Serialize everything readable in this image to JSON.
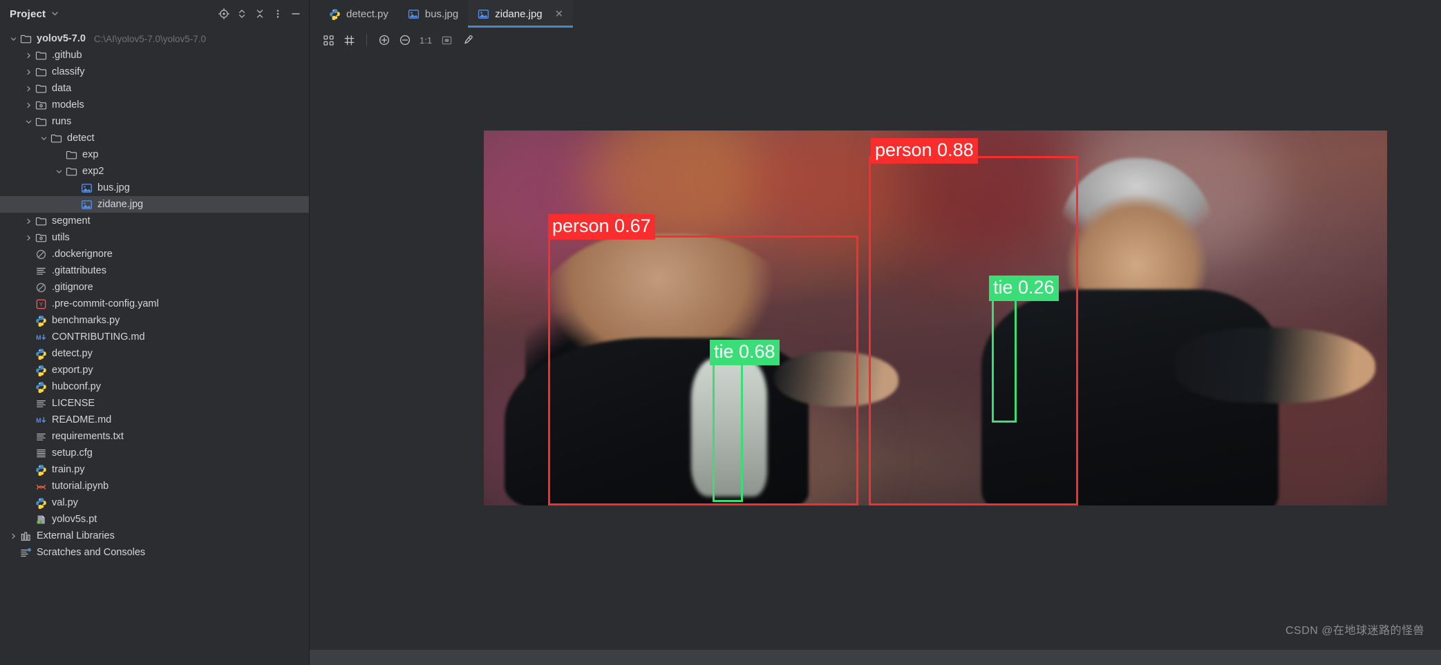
{
  "window": {
    "background_color": "#2b2d30",
    "accent_color": "#4a88c7"
  },
  "project_panel": {
    "title": "Project",
    "title_chevron": "chevron-down-icon",
    "toolbar_icons": [
      {
        "name": "locate-icon",
        "label": "Select Opened File"
      },
      {
        "name": "expand-collapse-icon",
        "label": "Expand All"
      },
      {
        "name": "collapse-all-icon",
        "label": "Collapse All"
      },
      {
        "name": "more-options-icon",
        "label": "Options"
      },
      {
        "name": "hide-icon",
        "label": "Hide"
      }
    ],
    "tree": [
      {
        "label": "yolov5-7.0",
        "path": "C:\\AI\\yolov5-7.0\\yolov5-7.0",
        "icon": "folder-icon",
        "indent": 0,
        "arrow": "down",
        "bold": true,
        "selected": false
      },
      {
        "label": ".github",
        "path": "",
        "icon": "folder-icon",
        "indent": 1,
        "arrow": "right",
        "bold": false,
        "selected": false
      },
      {
        "label": "classify",
        "path": "",
        "icon": "folder-icon",
        "indent": 1,
        "arrow": "right",
        "bold": false,
        "selected": false
      },
      {
        "label": "data",
        "path": "",
        "icon": "folder-icon",
        "indent": 1,
        "arrow": "right",
        "bold": false,
        "selected": false
      },
      {
        "label": "models",
        "path": "",
        "icon": "folder-source-icon",
        "indent": 1,
        "arrow": "right",
        "bold": false,
        "selected": false
      },
      {
        "label": "runs",
        "path": "",
        "icon": "folder-icon",
        "indent": 1,
        "arrow": "down",
        "bold": false,
        "selected": false
      },
      {
        "label": "detect",
        "path": "",
        "icon": "folder-icon",
        "indent": 2,
        "arrow": "down",
        "bold": false,
        "selected": false
      },
      {
        "label": "exp",
        "path": "",
        "icon": "folder-icon",
        "indent": 3,
        "arrow": "none",
        "bold": false,
        "selected": false
      },
      {
        "label": "exp2",
        "path": "",
        "icon": "folder-icon",
        "indent": 3,
        "arrow": "down",
        "bold": false,
        "selected": false
      },
      {
        "label": "bus.jpg",
        "path": "",
        "icon": "image-file-icon",
        "indent": 4,
        "arrow": "none",
        "bold": false,
        "selected": false
      },
      {
        "label": "zidane.jpg",
        "path": "",
        "icon": "image-file-icon",
        "indent": 4,
        "arrow": "none",
        "bold": false,
        "selected": true
      },
      {
        "label": "segment",
        "path": "",
        "icon": "folder-icon",
        "indent": 1,
        "arrow": "right",
        "bold": false,
        "selected": false
      },
      {
        "label": "utils",
        "path": "",
        "icon": "folder-source-icon",
        "indent": 1,
        "arrow": "right",
        "bold": false,
        "selected": false
      },
      {
        "label": ".dockerignore",
        "path": "",
        "icon": "ignore-file-icon",
        "indent": 1,
        "arrow": "none",
        "bold": false,
        "selected": false
      },
      {
        "label": ".gitattributes",
        "path": "",
        "icon": "text-file-icon",
        "indent": 1,
        "arrow": "none",
        "bold": false,
        "selected": false
      },
      {
        "label": ".gitignore",
        "path": "",
        "icon": "ignore-file-icon",
        "indent": 1,
        "arrow": "none",
        "bold": false,
        "selected": false
      },
      {
        "label": ".pre-commit-config.yaml",
        "path": "",
        "icon": "yaml-file-icon",
        "indent": 1,
        "arrow": "none",
        "bold": false,
        "selected": false
      },
      {
        "label": "benchmarks.py",
        "path": "",
        "icon": "python-file-icon",
        "indent": 1,
        "arrow": "none",
        "bold": false,
        "selected": false
      },
      {
        "label": "CONTRIBUTING.md",
        "path": "",
        "icon": "markdown-file-icon",
        "indent": 1,
        "arrow": "none",
        "bold": false,
        "selected": false
      },
      {
        "label": "detect.py",
        "path": "",
        "icon": "python-file-icon",
        "indent": 1,
        "arrow": "none",
        "bold": false,
        "selected": false
      },
      {
        "label": "export.py",
        "path": "",
        "icon": "python-file-icon",
        "indent": 1,
        "arrow": "none",
        "bold": false,
        "selected": false
      },
      {
        "label": "hubconf.py",
        "path": "",
        "icon": "python-file-icon",
        "indent": 1,
        "arrow": "none",
        "bold": false,
        "selected": false
      },
      {
        "label": "LICENSE",
        "path": "",
        "icon": "text-file-icon",
        "indent": 1,
        "arrow": "none",
        "bold": false,
        "selected": false
      },
      {
        "label": "README.md",
        "path": "",
        "icon": "markdown-file-icon",
        "indent": 1,
        "arrow": "none",
        "bold": false,
        "selected": false
      },
      {
        "label": "requirements.txt",
        "path": "",
        "icon": "text-file-icon",
        "indent": 1,
        "arrow": "none",
        "bold": false,
        "selected": false
      },
      {
        "label": "setup.cfg",
        "path": "",
        "icon": "config-file-icon",
        "indent": 1,
        "arrow": "none",
        "bold": false,
        "selected": false
      },
      {
        "label": "train.py",
        "path": "",
        "icon": "python-file-icon",
        "indent": 1,
        "arrow": "none",
        "bold": false,
        "selected": false
      },
      {
        "label": "tutorial.ipynb",
        "path": "",
        "icon": "notebook-file-icon",
        "indent": 1,
        "arrow": "none",
        "bold": false,
        "selected": false
      },
      {
        "label": "val.py",
        "path": "",
        "icon": "python-file-icon",
        "indent": 1,
        "arrow": "none",
        "bold": false,
        "selected": false
      },
      {
        "label": "yolov5s.pt",
        "path": "",
        "icon": "binary-file-icon",
        "indent": 1,
        "arrow": "none",
        "bold": false,
        "selected": false
      },
      {
        "label": "External Libraries",
        "path": "",
        "icon": "library-icon",
        "indent": 0,
        "arrow": "right",
        "bold": false,
        "selected": false
      },
      {
        "label": "Scratches and Consoles",
        "path": "",
        "icon": "scratches-icon",
        "indent": 0,
        "arrow": "none",
        "bold": false,
        "selected": false
      }
    ]
  },
  "tabs": [
    {
      "label": "detect.py",
      "icon": "python-file-icon",
      "active": false,
      "closable": false
    },
    {
      "label": "bus.jpg",
      "icon": "image-file-icon",
      "active": false,
      "closable": false
    },
    {
      "label": "zidane.jpg",
      "icon": "image-file-icon",
      "active": true,
      "closable": true,
      "close_icon": "close-icon"
    }
  ],
  "image_toolbar": {
    "buttons": [
      {
        "name": "toggle-transparency-grid-icon",
        "label": "Toggle transparency chessboard"
      },
      {
        "name": "toggle-grid-icon",
        "label": "Toggle grid"
      },
      {
        "name": "zoom-in-icon",
        "label": "Zoom in"
      },
      {
        "name": "zoom-out-icon",
        "label": "Zoom out"
      },
      {
        "name": "actual-size-label",
        "label": "1:1"
      },
      {
        "name": "fit-to-window-icon",
        "label": "Fit zoom to window"
      },
      {
        "name": "color-picker-icon",
        "label": "Pick color"
      }
    ],
    "zoom_level": "1:1"
  },
  "detections": [
    {
      "class": "person",
      "confidence": "0.67",
      "label": "person 0.67",
      "color": "#f03030"
    },
    {
      "class": "person",
      "confidence": "0.88",
      "label": "person 0.88",
      "color": "#f03030"
    },
    {
      "class": "tie",
      "confidence": "0.68",
      "label": "tie 0.68",
      "color": "#3fdc7a"
    },
    {
      "class": "tie",
      "confidence": "0.26",
      "label": "tie 0.26",
      "color": "#3fdc7a"
    }
  ],
  "watermark": {
    "text": "CSDN @在地球迷路的怪兽"
  }
}
